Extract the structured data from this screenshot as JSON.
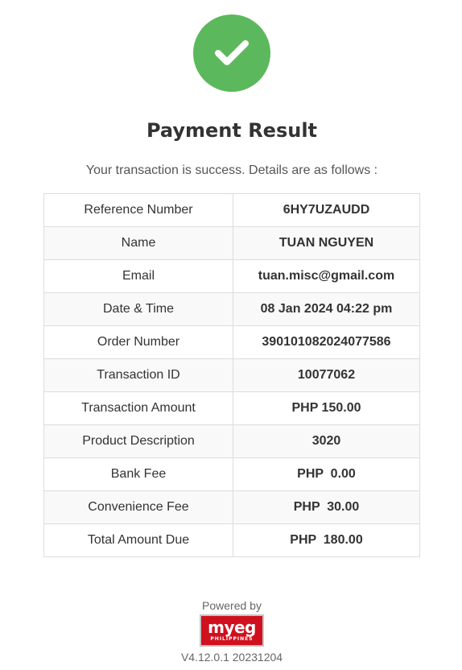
{
  "header": {
    "title": "Payment Result",
    "subtitle": "Your transaction is success. Details are as follows :",
    "status_icon": "checkmark-icon",
    "status_color": "#5cb85c"
  },
  "details": {
    "rows": [
      {
        "label": "Reference Number",
        "value": "6HY7UZAUDD"
      },
      {
        "label": "Name",
        "value": "TUAN NGUYEN"
      },
      {
        "label": "Email",
        "value": "tuan.misc@gmail.com"
      },
      {
        "label": "Date & Time",
        "value": "08 Jan 2024 04:22 pm"
      },
      {
        "label": "Order Number",
        "value": "390101082024077586"
      },
      {
        "label": "Transaction ID",
        "value": "10077062"
      },
      {
        "label": "Transaction Amount",
        "value": "PHP 150.00"
      },
      {
        "label": "Product Description",
        "value": "3020"
      },
      {
        "label": "Bank Fee",
        "value": "PHP  0.00"
      },
      {
        "label": "Convenience Fee",
        "value": "PHP  30.00"
      },
      {
        "label": "Total Amount Due",
        "value": "PHP  180.00"
      }
    ]
  },
  "footer": {
    "powered_by": "Powered by",
    "logo_main": "myeg",
    "logo_sub": "PHILIPPINES",
    "logo_color": "#d0101e",
    "version": "V4.12.0.1 20231204"
  }
}
